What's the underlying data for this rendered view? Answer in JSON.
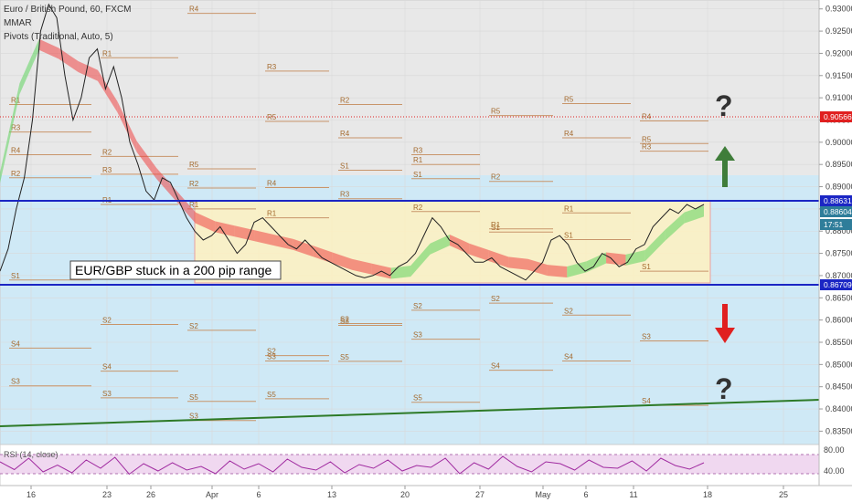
{
  "header": {
    "title": "Euro / British Pound, 60, FXCM",
    "indicator_1": "MMAR",
    "indicator_2": "Pivots (Traditional, Auto, 5)"
  },
  "annotation": "EUR/GBP stuck in a 200 pip range",
  "question_mark": "?",
  "rsi_label": "RSI (14, close)",
  "colors": {
    "range_band": "#fff1c0",
    "range_border": "#e8a0a0",
    "blue_band": "#cfe9f6",
    "grey_top": "#e8e8e8",
    "level_line": "#1b26c4",
    "trend_line": "#2d7a27",
    "pivot_line": "#c8956a",
    "up_arrow": "#3f7d3a",
    "down_arrow": "#e02020",
    "current_price_tag": "#e02020",
    "ribbon_up": "#5ed35e",
    "ribbon_down": "#ee4444"
  },
  "chart_data": {
    "type": "line",
    "symbol": "EUR/GBP",
    "timeframe": "60",
    "ylim": [
      0.832,
      0.932
    ],
    "y_ticks": [
      "0.93000",
      "0.92500",
      "0.92000",
      "0.91500",
      "0.91000",
      "0.90500",
      "0.90000",
      "0.89500",
      "0.89000",
      "0.88500",
      "0.88000",
      "0.87500",
      "0.87000",
      "0.86500",
      "0.86000",
      "0.85500",
      "0.85000",
      "0.84500",
      "0.84000",
      "0.83500"
    ],
    "x_ticks": [
      "16",
      "23",
      "26",
      "Apr",
      "6",
      "13",
      "20",
      "27",
      "May",
      "6",
      "11",
      "18",
      "25"
    ],
    "range_top": 0.88631,
    "range_bottom": 0.86709,
    "price_tags": [
      {
        "label": "0.90566",
        "color": "#e02020"
      },
      {
        "label": "0.88631",
        "color": "#1b26c4"
      },
      {
        "label": "0.88604",
        "color": "#2f7d9a"
      },
      {
        "label": "17:51",
        "color": "#2f7d9a"
      },
      {
        "label": "0.86709",
        "color": "#1b26c4"
      }
    ],
    "price_path": [
      [
        0.871,
        0.876,
        0.885,
        0.892,
        0.905,
        0.925,
        0.931,
        0.928,
        0.915,
        0.905,
        0.91,
        0.919,
        0.921,
        0.912,
        0.917,
        0.91,
        0.9,
        0.895,
        0.889,
        0.887,
        0.892,
        0.891,
        0.887,
        0.883,
        0.88
      ],
      [
        0.88,
        0.878,
        0.879,
        0.881,
        0.878,
        0.875,
        0.877,
        0.882,
        0.883,
        0.881,
        0.879,
        0.877,
        0.876,
        0.878,
        0.876,
        0.874,
        0.873,
        0.872,
        0.871,
        0.87,
        0.8695,
        0.87,
        0.871,
        0.87,
        0.872,
        0.873,
        0.875,
        0.879,
        0.883,
        0.881,
        0.878,
        0.877,
        0.875,
        0.873,
        0.873,
        0.874,
        0.872,
        0.871,
        0.87,
        0.869,
        0.871,
        0.873,
        0.878,
        0.879,
        0.877,
        0.873,
        0.871,
        0.872,
        0.875,
        0.874,
        0.872,
        0.873,
        0.876,
        0.877,
        0.881,
        0.883,
        0.885,
        0.884,
        0.886,
        0.885,
        0.886
      ]
    ],
    "ribbon": [
      0.892,
      0.912,
      0.922,
      0.92,
      0.917,
      0.915,
      0.908,
      0.899,
      0.893,
      0.888,
      0.883,
      0.881,
      0.88,
      0.879,
      0.878,
      0.877,
      0.8755,
      0.874,
      0.8725,
      0.8715,
      0.8705,
      0.871,
      0.876,
      0.878,
      0.876,
      0.8745,
      0.873,
      0.8725,
      0.8712,
      0.8708,
      0.872,
      0.874,
      0.8735,
      0.8745,
      0.879,
      0.883,
      0.8845
    ],
    "pivots": [
      {
        "label": "R1",
        "y": 0.9085
      },
      {
        "label": "R1",
        "y": 0.919
      },
      {
        "label": "R4",
        "y": 0.929
      },
      {
        "label": "R3",
        "y": 0.916
      },
      {
        "label": "R2",
        "y": 0.9085
      },
      {
        "label": "R1",
        "y": 0.895
      },
      {
        "label": "R5",
        "y": 0.906
      },
      {
        "label": "R4",
        "y": 0.901
      },
      {
        "label": "R3",
        "y": 0.898
      },
      {
        "label": "R2",
        "y": 0.892
      },
      {
        "label": "R1",
        "y": 0.886
      },
      {
        "label": "R5",
        "y": 0.894
      },
      {
        "label": "R4",
        "y": 0.8898
      },
      {
        "label": "R3",
        "y": 0.8873
      },
      {
        "label": "R2",
        "y": 0.8844
      },
      {
        "label": "R1",
        "y": 0.8805
      },
      {
        "label": "R5",
        "y": 0.9087
      },
      {
        "label": "R4",
        "y": 0.9048
      },
      {
        "label": "R3",
        "y": 0.9023
      },
      {
        "label": "R2",
        "y": 0.8968
      },
      {
        "label": "R1",
        "y": 0.885
      },
      {
        "label": "R5",
        "y": 0.9047
      },
      {
        "label": "R4",
        "y": 0.901
      },
      {
        "label": "R3",
        "y": 0.8972
      },
      {
        "label": "R2",
        "y": 0.8912
      },
      {
        "label": "R1",
        "y": 0.8841
      },
      {
        "label": "R5",
        "y": 0.8997
      },
      {
        "label": "R4",
        "y": 0.8972
      },
      {
        "label": "R3",
        "y": 0.8928
      },
      {
        "label": "R2",
        "y": 0.8897
      },
      {
        "label": "R1",
        "y": 0.883
      },
      {
        "label": "S1",
        "y": 0.8937
      },
      {
        "label": "S1",
        "y": 0.8918
      },
      {
        "label": "S1",
        "y": 0.8798
      },
      {
        "label": "S1",
        "y": 0.8781
      },
      {
        "label": "S1",
        "y": 0.871
      },
      {
        "label": "S1",
        "y": 0.869
      },
      {
        "label": "S2",
        "y": 0.859
      },
      {
        "label": "S2",
        "y": 0.8577
      },
      {
        "label": "S2",
        "y": 0.852
      },
      {
        "label": "S2",
        "y": 0.8592
      },
      {
        "label": "S2",
        "y": 0.8622
      },
      {
        "label": "S2",
        "y": 0.8638
      },
      {
        "label": "S2",
        "y": 0.8611
      },
      {
        "label": "S3",
        "y": 0.8553
      },
      {
        "label": "S3",
        "y": 0.8452
      },
      {
        "label": "S3",
        "y": 0.8425
      },
      {
        "label": "S3",
        "y": 0.8374
      },
      {
        "label": "S3",
        "y": 0.8508
      },
      {
        "label": "S3",
        "y": 0.8588
      },
      {
        "label": "S3",
        "y": 0.8557
      },
      {
        "label": "S4",
        "y": 0.8487
      },
      {
        "label": "S4",
        "y": 0.8508
      },
      {
        "label": "S4",
        "y": 0.8408
      },
      {
        "label": "S4",
        "y": 0.8537
      },
      {
        "label": "S4",
        "y": 0.8485
      },
      {
        "label": "S5",
        "y": 0.8417
      },
      {
        "label": "S5",
        "y": 0.8423
      },
      {
        "label": "S5",
        "y": 0.8507
      },
      {
        "label": "S5",
        "y": 0.8415
      }
    ],
    "rsi": {
      "ticks": [
        "80.00",
        "40.00"
      ],
      "values": [
        62,
        45,
        70,
        40,
        55,
        38,
        66,
        48,
        72,
        35,
        58,
        42,
        60,
        44,
        52,
        36,
        64,
        46,
        58,
        40,
        68,
        50,
        44,
        62,
        38,
        56,
        48,
        66,
        42,
        54,
        50,
        70,
        36,
        60,
        46,
        74,
        52,
        40,
        62,
        58,
        44,
        66,
        50,
        48,
        64,
        42,
        70,
        54,
        46,
        60
      ]
    }
  }
}
